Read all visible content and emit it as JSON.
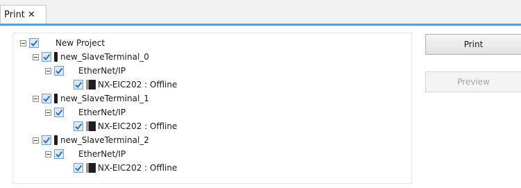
{
  "tab": {
    "label": "Print",
    "close_glyph": "✕"
  },
  "tree": {
    "root": {
      "label": "New Project",
      "checked": true
    },
    "terminals": [
      {
        "label": "new_SlaveTerminal_0",
        "checked": true,
        "network": {
          "label": "EtherNet/IP",
          "checked": true,
          "device": {
            "label": "NX-EIC202 : Offline",
            "checked": true
          }
        }
      },
      {
        "label": "new_SlaveTerminal_1",
        "checked": true,
        "network": {
          "label": "EtherNet/IP",
          "checked": true,
          "device": {
            "label": "NX-EIC202 : Offline",
            "checked": true
          }
        }
      },
      {
        "label": "new_SlaveTerminal_2",
        "checked": true,
        "network": {
          "label": "EtherNet/IP",
          "checked": true,
          "device": {
            "label": "NX-EIC202 : Offline",
            "checked": true
          }
        }
      }
    ]
  },
  "buttons": {
    "print": "Print",
    "preview": "Preview",
    "preview_enabled": false
  },
  "colors": {
    "accent": "#5b9bd5",
    "checkbox_border": "#6e9ed6",
    "checkmark": "#2f6fc0"
  },
  "icons": {
    "expander": "collapse-minus-icon",
    "checkbox": "checkbox-checked-icon",
    "slave_terminal": "slave-terminal-device-icon",
    "coupler": "coupler-unit-icon"
  }
}
